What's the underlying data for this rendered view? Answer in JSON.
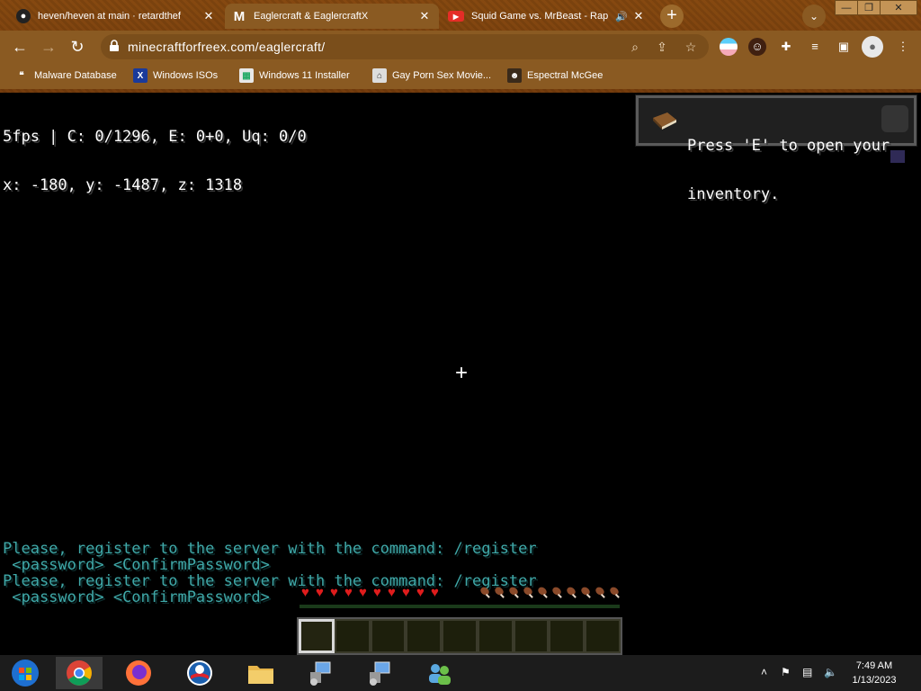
{
  "browser": {
    "tabs": [
      {
        "title": "heven/heven at main · retardthef",
        "icon": "github-icon",
        "active": false
      },
      {
        "title": "Eaglercraft & EaglercraftX",
        "icon": "medium-m-icon",
        "active": true
      },
      {
        "title": "Squid Game vs. MrBeast - Rap",
        "icon": "youtube-icon",
        "active": false,
        "audio": true
      }
    ],
    "new_tab_label": "+",
    "url": "minecraftforfreex.com/eaglercraft/",
    "bookmarks": [
      {
        "label": "Malware Database",
        "icon": "bookmark-icon"
      },
      {
        "label": "Windows ISOs",
        "icon": "x-icon"
      },
      {
        "label": "Windows 11 Installer",
        "icon": "installer-icon"
      },
      {
        "label": "Gay Porn Sex Movie...",
        "icon": "globe-icon"
      },
      {
        "label": "Espectral McGee",
        "icon": "avatar-icon"
      }
    ]
  },
  "game": {
    "debug_line1": "5fps | C: 0/1296, E: 0+0, Uq: 0/0",
    "debug_line2": "x: -180, y: -1487, z: 1318",
    "toast_line1": "Press 'E' to open your",
    "toast_line2": "inventory.",
    "crosshair": "+",
    "chat": [
      "Please, register to the server with the command: /register",
      " <password> <ConfirmPassword>",
      "Please, register to the server with the command: /register",
      " <password> <ConfirmPassword>"
    ],
    "health_hearts": 10,
    "hunger_drumsticks": 10,
    "hotbar_slots": 9,
    "selected_slot": 1,
    "colors": {
      "chat": "#3fa8a8",
      "heart": "#e01c1c"
    }
  },
  "taskbar": {
    "apps": [
      "windows-start-icon",
      "chrome-icon",
      "firefox-icon",
      "obama-icon",
      "file-explorer-icon",
      "network-computer-icon",
      "network-computer-icon",
      "users-icon"
    ],
    "time": "7:49 AM",
    "date": "1/13/2023"
  }
}
